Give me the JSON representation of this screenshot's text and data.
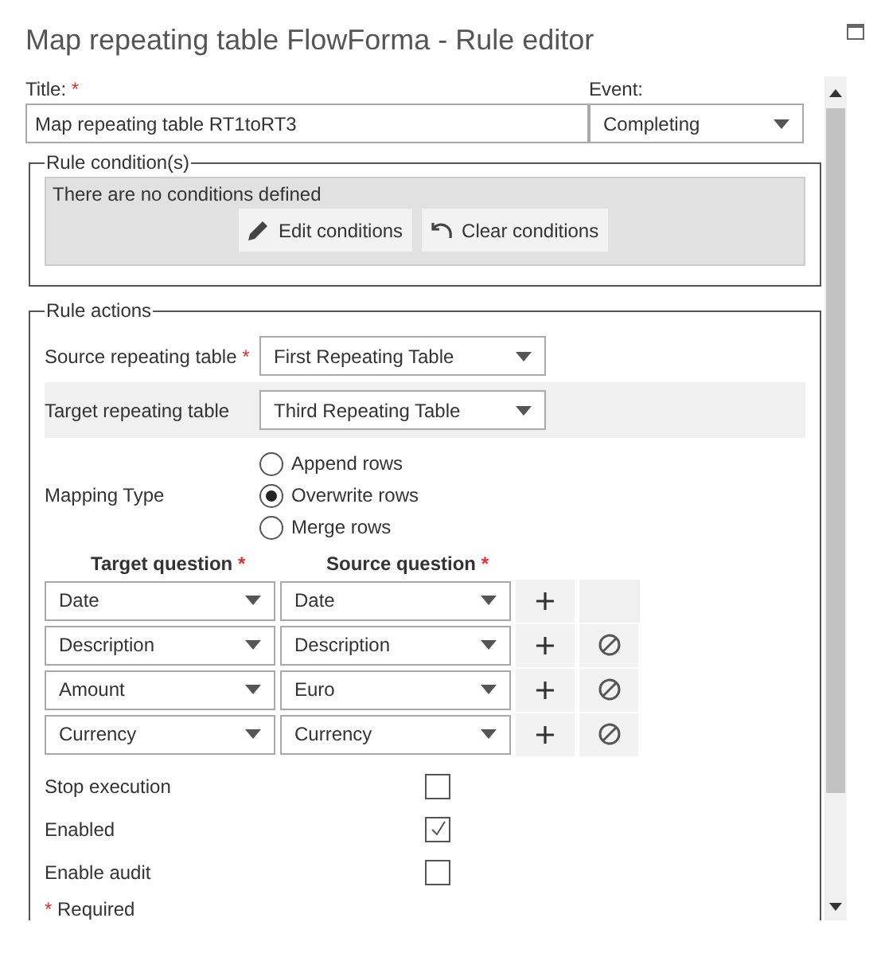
{
  "window": {
    "title": "Map repeating table FlowForma - Rule editor"
  },
  "title_field": {
    "label": "Title:",
    "required_mark": "*",
    "value": "Map repeating table RT1toRT3"
  },
  "event_field": {
    "label": "Event:",
    "value": "Completing"
  },
  "rule_conditions": {
    "legend": "Rule condition(s)",
    "message": "There are no conditions defined",
    "buttons": [
      {
        "kind": "edit",
        "label": "Edit conditions"
      },
      {
        "kind": "clear",
        "label": "Clear conditions"
      }
    ]
  },
  "rule_actions": {
    "legend": "Rule actions",
    "source_table": {
      "label": "Source repeating table",
      "required_mark": "*",
      "value": "First Repeating Table"
    },
    "target_table": {
      "label": "Target repeating table",
      "value": "Third Repeating Table"
    },
    "mapping_type": {
      "label": "Mapping Type",
      "options": [
        {
          "label": "Append rows",
          "selected": false
        },
        {
          "label": "Overwrite rows",
          "selected": true
        },
        {
          "label": "Merge rows",
          "selected": false
        }
      ]
    },
    "mapping_columns": [
      {
        "label": "Target question",
        "required_mark": "*"
      },
      {
        "label": "Source question",
        "required_mark": "*"
      }
    ],
    "mappings": [
      {
        "target": "Date",
        "source": "Date",
        "removable": false
      },
      {
        "target": "Description",
        "source": "Description",
        "removable": true
      },
      {
        "target": "Amount",
        "source": "Euro",
        "removable": true
      },
      {
        "target": "Currency",
        "source": "Currency",
        "removable": true
      }
    ],
    "options": [
      {
        "label": "Stop execution",
        "checked": false
      },
      {
        "label": "Enabled",
        "checked": true
      },
      {
        "label": "Enable audit",
        "checked": false
      }
    ],
    "required_note": {
      "mark": "*",
      "text": "Required"
    }
  }
}
